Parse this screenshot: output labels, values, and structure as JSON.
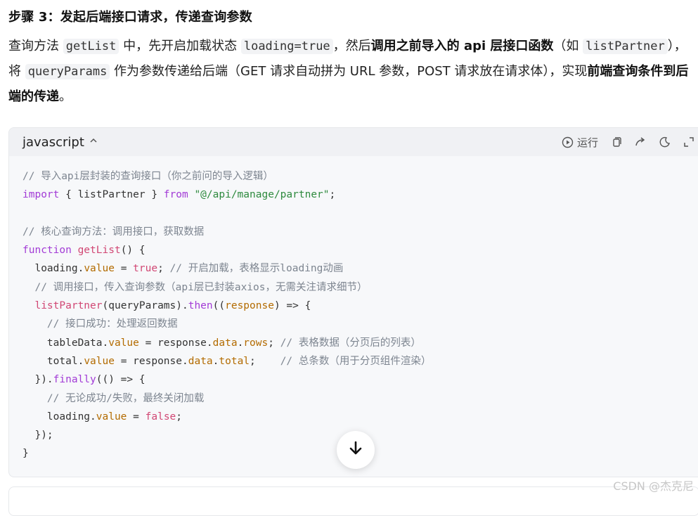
{
  "heading": "步骤 3：发起后端接口请求，传递查询参数",
  "paragraph": {
    "p1": "查询方法 ",
    "c1": "getList",
    "p2": " 中，先开启加载状态 ",
    "c2": "loading=true",
    "p3": "，然后",
    "b1": "调用之前导入的 api 层接口函数",
    "p4": "（如 ",
    "c3": "listPartner",
    "p5": "），将 ",
    "c4": "queryParams",
    "p6": " 作为参数传递给后端（GET 请求自动拼为 URL 参数，POST 请求放在请求体），实现",
    "b2": "前端查询条件到后端的传递",
    "p7": "。"
  },
  "code_block": {
    "language": "javascript",
    "run_label": "运行",
    "icons": [
      "play-circle-icon",
      "copy-icon",
      "share-icon",
      "theme-icon",
      "expand-icon"
    ],
    "line1_comment": "// 导入api层封装的查询接口（你之前问的导入逻辑）",
    "import_kw": "import",
    "import_braces": " { listPartner } ",
    "from_kw": "from",
    "import_path": "\"@/api/manage/partner\"",
    "line2_comment": "// 核心查询方法：调用接口，获取数据",
    "function_kw": "function",
    "fn_name": "getList",
    "loading_comment": "// 开启加载，表格显示loading动画",
    "call_comment": "// 调用接口，传入查询参数（api层已封装axios，无需关注请求细节）",
    "success_comment": "// 接口成功：处理返回数据",
    "rows_comment": "// 表格数据（分页后的列表）",
    "total_comment": "// 总条数（用于分页组件渲染）",
    "finally_comment": "// 无论成功/失败，最终关闭加载"
  },
  "watermark": "CSDN @杰克尼"
}
